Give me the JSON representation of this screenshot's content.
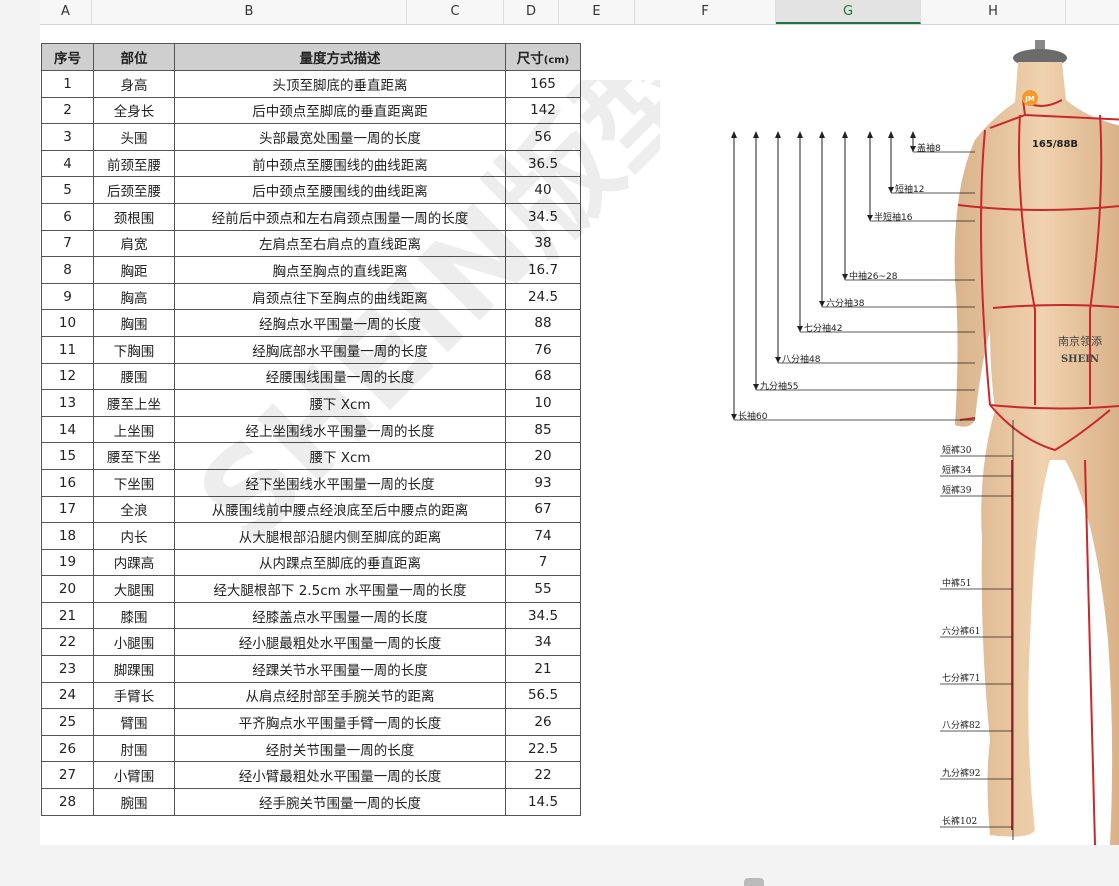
{
  "columns": [
    "A",
    "B",
    "C",
    "D",
    "E",
    "F",
    "G",
    "H"
  ],
  "selected_column": "G",
  "table": {
    "headers": [
      "序号",
      "部位",
      "量度方式描述",
      "尺寸"
    ],
    "size_unit": "(cm)",
    "rows": [
      [
        "1",
        "身高",
        "头顶至脚底的垂直距离",
        "165"
      ],
      [
        "2",
        "全身长",
        "后中颈点至脚底的垂直距离距",
        "142"
      ],
      [
        "3",
        "头围",
        "头部最宽处围量一周的长度",
        "56"
      ],
      [
        "4",
        "前颈至腰",
        "前中颈点至腰围线的曲线距离",
        "36.5"
      ],
      [
        "5",
        "后颈至腰",
        "后中颈点至腰围线的曲线距离",
        "40"
      ],
      [
        "6",
        "颈根围",
        "经前后中颈点和左右肩颈点围量一周的长度",
        "34.5"
      ],
      [
        "7",
        "肩宽",
        "左肩点至右肩点的直线距离",
        "38"
      ],
      [
        "8",
        "胸距",
        "胸点至胸点的直线距离",
        "16.7"
      ],
      [
        "9",
        "胸高",
        "肩颈点往下至胸点的曲线距离",
        "24.5"
      ],
      [
        "10",
        "胸围",
        "经胸点水平围量一周的长度",
        "88"
      ],
      [
        "11",
        "下胸围",
        "经胸底部水平围量一周的长度",
        "76"
      ],
      [
        "12",
        "腰围",
        "经腰围线围量一周的长度",
        "68"
      ],
      [
        "13",
        "腰至上坐",
        "腰下 Xcm",
        "10"
      ],
      [
        "14",
        "上坐围",
        "经上坐围线水平围量一周的长度",
        "85"
      ],
      [
        "15",
        "腰至下坐",
        "腰下 Xcm",
        "20"
      ],
      [
        "16",
        "下坐围",
        "经下坐围线水平围量一周的长度",
        "93"
      ],
      [
        "17",
        "全浪",
        "从腰围线前中腰点经浪底至后中腰点的距离",
        "67"
      ],
      [
        "18",
        "内长",
        "从大腿根部沿腿内侧至脚底的距离",
        "74"
      ],
      [
        "19",
        "内踝高",
        "从内踝点至脚底的垂直距离",
        "7"
      ],
      [
        "20",
        "大腿围",
        "经大腿根部下 2.5cm 水平围量一周的长度",
        "55"
      ],
      [
        "21",
        "膝围",
        "经膝盖点水平围量一周的长度",
        "34.5"
      ],
      [
        "22",
        "小腿围",
        "经小腿最粗处水平围量一周的长度",
        "34"
      ],
      [
        "23",
        "脚踝围",
        "经踝关节水平围量一周的长度",
        "21"
      ],
      [
        "24",
        "手臂长",
        "从肩点经肘部至手腕关节的距离",
        "56.5"
      ],
      [
        "25",
        "臂围",
        "平齐胸点水平围量手臂一周的长度",
        "26"
      ],
      [
        "26",
        "肘围",
        "经肘关节围量一周的长度",
        "22.5"
      ],
      [
        "27",
        "小臂围",
        "经小臂最粗处水平围量一周的长度",
        "22"
      ],
      [
        "28",
        "腕围",
        "经手腕关节围量一周的长度",
        "14.5"
      ]
    ]
  },
  "watermark_text": "SHEIN版型",
  "mannequin": {
    "logo": "JM",
    "size_label": "165/88B",
    "brand_cn": "南京领添",
    "brand_en": "SHEIN",
    "sleeve_labels": [
      "盖袖8",
      "短袖12",
      "半短袖16",
      "中袖26~28",
      "六分袖38",
      "七分袖42",
      "八分袖48",
      "九分袖55",
      "长袖60"
    ],
    "pant_labels": [
      "短裤30",
      "短裤34",
      "短裤39",
      "中裤51",
      "六分裤61",
      "七分裤71",
      "八分裤82",
      "九分裤92",
      "长裤102"
    ]
  },
  "colors": {
    "table_header": "#cfcfcf",
    "selected_col": "#217346",
    "skin": "#e8c7a2",
    "seam": "#c8282c"
  }
}
